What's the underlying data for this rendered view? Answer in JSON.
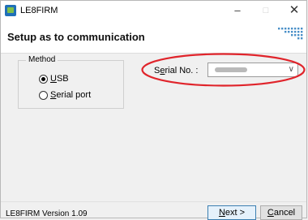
{
  "window": {
    "title": "LE8FIRM",
    "minimize": "–",
    "maximize": "□",
    "close": "✕"
  },
  "header": {
    "title": "Setup as to communication"
  },
  "method_group": {
    "legend": "Method",
    "options": [
      {
        "label_underlined": "U",
        "label_rest": "SB",
        "checked": true
      },
      {
        "label_underlined": "S",
        "label_rest": "erial port",
        "checked": false
      }
    ]
  },
  "serial": {
    "label_prefix": "S",
    "label_underlined": "e",
    "label_suffix": "rial No. :",
    "value_obscured": true,
    "chevron": "∨"
  },
  "highlight": {
    "color": "#e0242b"
  },
  "footer": {
    "version": "LE8FIRM Version 1.09",
    "next_underlined": "N",
    "next_rest": "ext >",
    "cancel_underlined": "C",
    "cancel_rest": "ancel"
  },
  "colors": {
    "logo_dots": "#4a90c8",
    "app_icon": "#1f6fb8"
  }
}
